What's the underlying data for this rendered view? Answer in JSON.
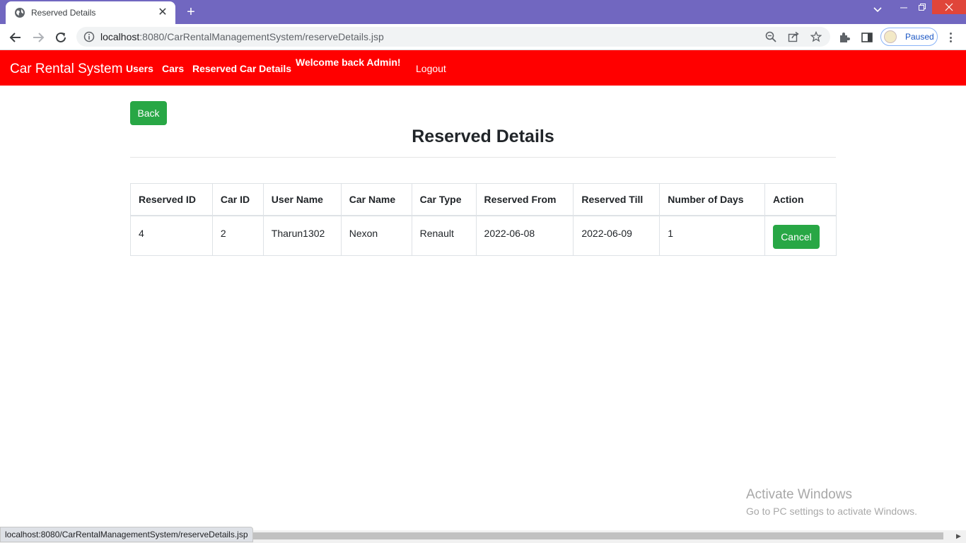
{
  "browser": {
    "tab_title": "Reserved Details",
    "tab_close": "✕",
    "new_tab": "+",
    "url_host": "localhost",
    "url_rest": ":8080/CarRentalManagementSystem/reserveDetails.jsp",
    "profile_status": "Paused",
    "status_url": "localhost:8080/CarRentalManagementSystem/reserveDetails.jsp"
  },
  "navbar": {
    "brand": "Car Rental System",
    "links": [
      "Users",
      "Cars",
      "Reserved Car Details"
    ],
    "welcome": "Welcome back Admin!",
    "logout": "Logout",
    "bg_color": "#ff0000"
  },
  "content": {
    "back_label": "Back",
    "title": "Reserved Details",
    "button_color": "#28a745"
  },
  "table": {
    "headers": [
      "Reserved ID",
      "Car ID",
      "User Name",
      "Car Name",
      "Car Type",
      "Reserved From",
      "Reserved Till",
      "Number of Days",
      "Action"
    ],
    "rows": [
      {
        "reserved_id": "4",
        "car_id": "2",
        "user_name": "Tharun1302",
        "car_name": "Nexon",
        "car_type": "Renault",
        "reserved_from": "2022-06-08",
        "reserved_till": "2022-06-09",
        "days": "1",
        "action_label": "Cancel"
      }
    ]
  },
  "watermark": {
    "title": "Activate Windows",
    "subtitle": "Go to PC settings to activate Windows."
  }
}
